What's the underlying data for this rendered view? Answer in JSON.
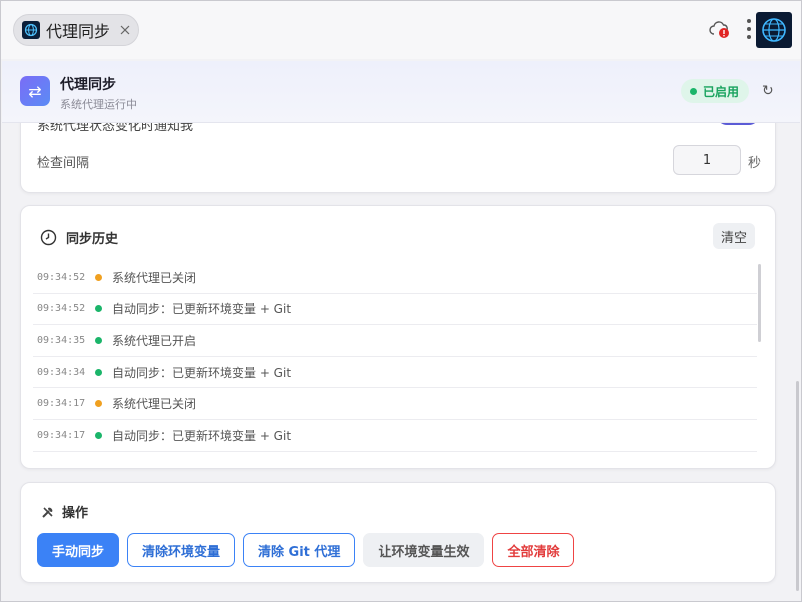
{
  "tab": {
    "title": "代理同步"
  },
  "header": {
    "title": "代理同步",
    "subtitle": "系统代理运行中",
    "status": "已启用",
    "refresh_icon": "↻"
  },
  "settings": {
    "notify_label": "系统代理状态变化时通知我",
    "notify_enabled": true,
    "interval_label": "检查间隔",
    "interval_value": "1",
    "interval_unit": "秒"
  },
  "history": {
    "title": "同步历史",
    "clear_label": "清空",
    "rows": [
      {
        "time": "09:34:52",
        "status": "warn",
        "message": "系统代理已关闭"
      },
      {
        "time": "09:34:52",
        "status": "ok",
        "message": "自动同步：已更新环境变量 + Git"
      },
      {
        "time": "09:34:35",
        "status": "ok",
        "message": "系统代理已开启"
      },
      {
        "time": "09:34:34",
        "status": "ok",
        "message": "自动同步：已更新环境变量 + Git"
      },
      {
        "time": "09:34:17",
        "status": "warn",
        "message": "系统代理已关闭"
      },
      {
        "time": "09:34:17",
        "status": "ok",
        "message": "自动同步：已更新环境变量 + Git"
      }
    ]
  },
  "actions": {
    "title": "操作",
    "buttons": [
      {
        "label": "手动同步",
        "style": "primary"
      },
      {
        "label": "清除环境变量",
        "style": "outline"
      },
      {
        "label": "清除 Git 代理",
        "style": "outline"
      },
      {
        "label": "让环境变量生效",
        "style": "gray"
      },
      {
        "label": "全部清除",
        "style": "danger"
      }
    ]
  },
  "colors": {
    "accent": "#3b82f6",
    "ok": "#1bb56a",
    "warn": "#f0a020",
    "danger": "#ef4444"
  }
}
